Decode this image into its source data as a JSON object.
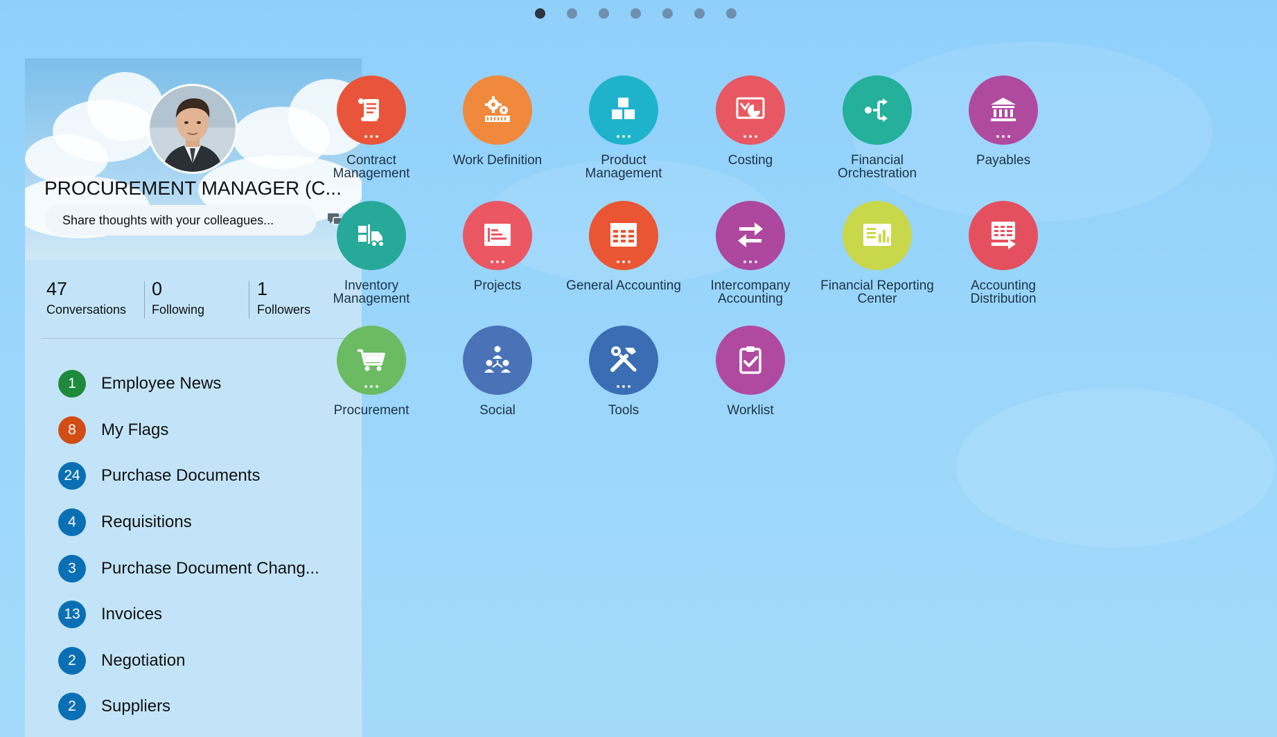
{
  "pager": {
    "count": 7,
    "active": 0
  },
  "profile": {
    "name": "PROCUREMENT MANAGER (C...",
    "share_placeholder": "Share thoughts with your colleagues...",
    "stats": [
      {
        "value": "47",
        "label": "Conversations"
      },
      {
        "value": "0",
        "label": "Following"
      },
      {
        "value": "1",
        "label": "Followers"
      }
    ]
  },
  "worklist": [
    {
      "count": "1",
      "label": "Employee News",
      "color": "#1e8a3c"
    },
    {
      "count": "8",
      "label": "My Flags",
      "color": "#d24d16"
    },
    {
      "count": "24",
      "label": "Purchase Documents",
      "color": "#0a6fb5"
    },
    {
      "count": "4",
      "label": "Requisitions",
      "color": "#0a6fb5"
    },
    {
      "count": "3",
      "label": "Purchase Document Chang...",
      "color": "#0a6fb5"
    },
    {
      "count": "13",
      "label": "Invoices",
      "color": "#0a6fb5"
    },
    {
      "count": "2",
      "label": "Negotiation",
      "color": "#0a6fb5"
    },
    {
      "count": "2",
      "label": "Suppliers",
      "color": "#0a6fb5"
    }
  ],
  "apps": [
    {
      "name": "Contract Management",
      "line1": "Contract",
      "line2": "Management",
      "icon": "scroll-icon",
      "color": "#e9553a",
      "more": true
    },
    {
      "name": "Work Definition",
      "line1": "Work Definition",
      "line2": "",
      "icon": "gears-icon",
      "color": "#f0893c",
      "more": false
    },
    {
      "name": "Product Management",
      "line1": "Product",
      "line2": "Management",
      "icon": "boxes-icon",
      "color": "#1fb3cb",
      "more": true
    },
    {
      "name": "Costing",
      "line1": "Costing",
      "line2": "",
      "icon": "costing-chart-icon",
      "color": "#e85862",
      "more": true
    },
    {
      "name": "Financial Orchestration",
      "line1": "Financial",
      "line2": "Orchestration",
      "icon": "branch-arrows-icon",
      "color": "#24b09a",
      "more": false
    },
    {
      "name": "Payables",
      "line1": "Payables",
      "line2": "",
      "icon": "bank-icon",
      "color": "#b04a9f",
      "more": true
    },
    {
      "name": "Inventory Management",
      "line1": "Inventory",
      "line2": "Management",
      "icon": "forklift-icon",
      "color": "#27a99a",
      "more": false
    },
    {
      "name": "Projects",
      "line1": "Projects",
      "line2": "",
      "icon": "gantt-icon",
      "color": "#ea5763",
      "more": true
    },
    {
      "name": "General Accounting",
      "line1": "General Accounting",
      "line2": "",
      "icon": "ledger-icon",
      "color": "#ea5533",
      "more": true
    },
    {
      "name": "Intercompany Accounting",
      "line1": "Intercompany",
      "line2": "Accounting",
      "icon": "swap-arrows-icon",
      "color": "#ae479e",
      "more": true
    },
    {
      "name": "Financial Reporting Center",
      "line1": "Financial Reporting",
      "line2": "Center",
      "icon": "report-icon",
      "color": "#c9d84a",
      "more": false
    },
    {
      "name": "Accounting Distribution",
      "line1": "Accounting",
      "line2": "Distribution",
      "icon": "distribution-icon",
      "color": "#e5505f",
      "more": false
    },
    {
      "name": "Procurement",
      "line1": "Procurement",
      "line2": "",
      "icon": "cart-icon",
      "color": "#6abb62",
      "more": true
    },
    {
      "name": "Social",
      "line1": "Social",
      "line2": "",
      "icon": "people-icon",
      "color": "#4a72b7",
      "more": false
    },
    {
      "name": "Tools",
      "line1": "Tools",
      "line2": "",
      "icon": "tools-icon",
      "color": "#3a6db3",
      "more": true
    },
    {
      "name": "Worklist",
      "line1": "Worklist",
      "line2": "",
      "icon": "clipboard-check-icon",
      "color": "#b04aa0",
      "more": false
    }
  ]
}
